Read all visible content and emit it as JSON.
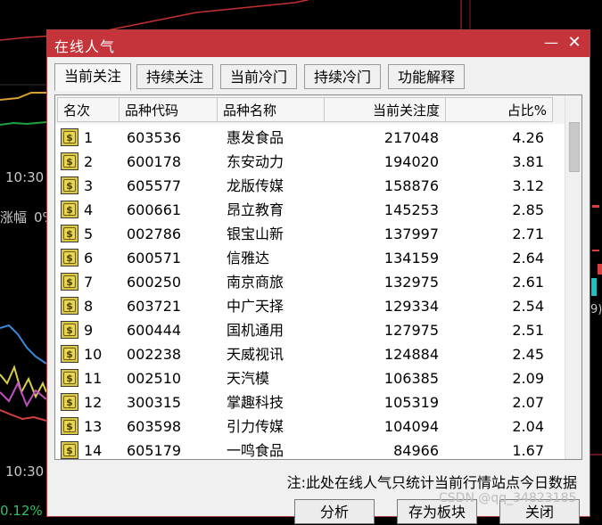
{
  "background": {
    "time_label_1": "10:30",
    "time_label_2": "10:30",
    "zhangfu_label": "涨幅",
    "zhangfu_value": "0%",
    "pct_label": "0.12%",
    "right_label": "9)"
  },
  "dialog": {
    "title": "在线人气",
    "minimize_symbol": "—",
    "close_symbol": "✕",
    "tabs": [
      {
        "label": "当前关注",
        "active": true
      },
      {
        "label": "持续关注",
        "active": false
      },
      {
        "label": "当前冷门",
        "active": false
      },
      {
        "label": "持续冷门",
        "active": false
      },
      {
        "label": "功能解释",
        "active": false
      }
    ],
    "columns": [
      "名次",
      "品种代码",
      "品种名称",
      "当前关注度",
      "占比%"
    ],
    "rows": [
      {
        "rank": "1",
        "code": "603536",
        "name": "惠发食品",
        "attention": "217048",
        "ratio": "4.26"
      },
      {
        "rank": "2",
        "code": "600178",
        "name": "东安动力",
        "attention": "194020",
        "ratio": "3.81"
      },
      {
        "rank": "3",
        "code": "605577",
        "name": "龙版传媒",
        "attention": "158876",
        "ratio": "3.12"
      },
      {
        "rank": "4",
        "code": "600661",
        "name": "昂立教育",
        "attention": "145253",
        "ratio": "2.85"
      },
      {
        "rank": "5",
        "code": "002786",
        "name": "银宝山新",
        "attention": "137997",
        "ratio": "2.71"
      },
      {
        "rank": "6",
        "code": "600571",
        "name": "信雅达",
        "attention": "134159",
        "ratio": "2.64"
      },
      {
        "rank": "7",
        "code": "600250",
        "name": "南京商旅",
        "attention": "132975",
        "ratio": "2.61"
      },
      {
        "rank": "8",
        "code": "603721",
        "name": "中广天择",
        "attention": "129334",
        "ratio": "2.54"
      },
      {
        "rank": "9",
        "code": "600444",
        "name": "国机通用",
        "attention": "127975",
        "ratio": "2.51"
      },
      {
        "rank": "10",
        "code": "002238",
        "name": "天威视讯",
        "attention": "124884",
        "ratio": "2.45"
      },
      {
        "rank": "11",
        "code": "002510",
        "name": "天汽模",
        "attention": "106385",
        "ratio": "2.09"
      },
      {
        "rank": "12",
        "code": "300315",
        "name": "掌趣科技",
        "attention": "105319",
        "ratio": "2.07"
      },
      {
        "rank": "13",
        "code": "603598",
        "name": "引力传媒",
        "attention": "104094",
        "ratio": "2.04"
      },
      {
        "rank": "14",
        "code": "605179",
        "name": "一鸣食品",
        "attention": "84966",
        "ratio": "1.67"
      }
    ],
    "row_icon_symbol": "$",
    "note": "注:此处在线人气只统计当前行情站点今日数据",
    "buttons": {
      "analyze": "分析",
      "save_block": "存为板块",
      "close": "关闭"
    }
  },
  "watermark": "CSDN @qq_34823185",
  "colors": {
    "title_bar": "#c4343a",
    "icon_fill": "#e8d654"
  }
}
